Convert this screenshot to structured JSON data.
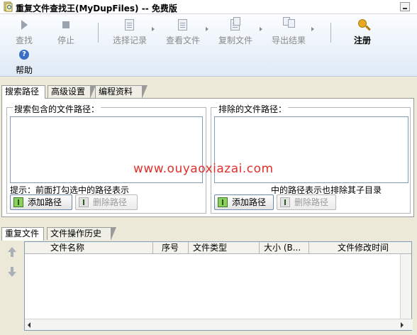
{
  "window": {
    "title": "重复文件查找王(MyDupFiles) -- 免费版"
  },
  "toolbar": {
    "buttons": [
      {
        "label": "查找",
        "icon": "play-icon",
        "enabled": false
      },
      {
        "label": "停止",
        "icon": "stop-icon",
        "enabled": false
      },
      {
        "label": "选择记录",
        "icon": "checklist-icon",
        "enabled": false
      },
      {
        "label": "查看文件",
        "icon": "view-file-icon",
        "enabled": false
      },
      {
        "label": "复制文件",
        "icon": "copy-file-icon",
        "enabled": false
      },
      {
        "label": "导出结果",
        "icon": "export-icon",
        "enabled": false
      },
      {
        "label": "注册",
        "icon": "key-icon",
        "enabled": true
      },
      {
        "label": "帮助",
        "icon": "help-icon",
        "enabled": true
      }
    ]
  },
  "top_tabs": [
    "搜索路径",
    "高级设置",
    "编程资料"
  ],
  "search_paths": {
    "include_title": "搜索包含的文件路径：",
    "exclude_title": "排除的文件路径：",
    "include_hint": "提示：前面打勾选中的路径表示",
    "exclude_hint": "中的路径表示也排除其子目录",
    "add_button": "添加路径",
    "delete_button": "删除路径"
  },
  "watermark": "www.ouyaoxiazai.com",
  "bottom_tabs": [
    "重复文件",
    "文件操作历史"
  ],
  "results_table": {
    "columns": [
      "文件名称",
      "序号",
      "文件类型",
      "大小 (B...",
      "文件修改时间"
    ]
  },
  "colors": {
    "watermark": "#e0302b",
    "toolbar_bg": "#dfeaf6"
  }
}
